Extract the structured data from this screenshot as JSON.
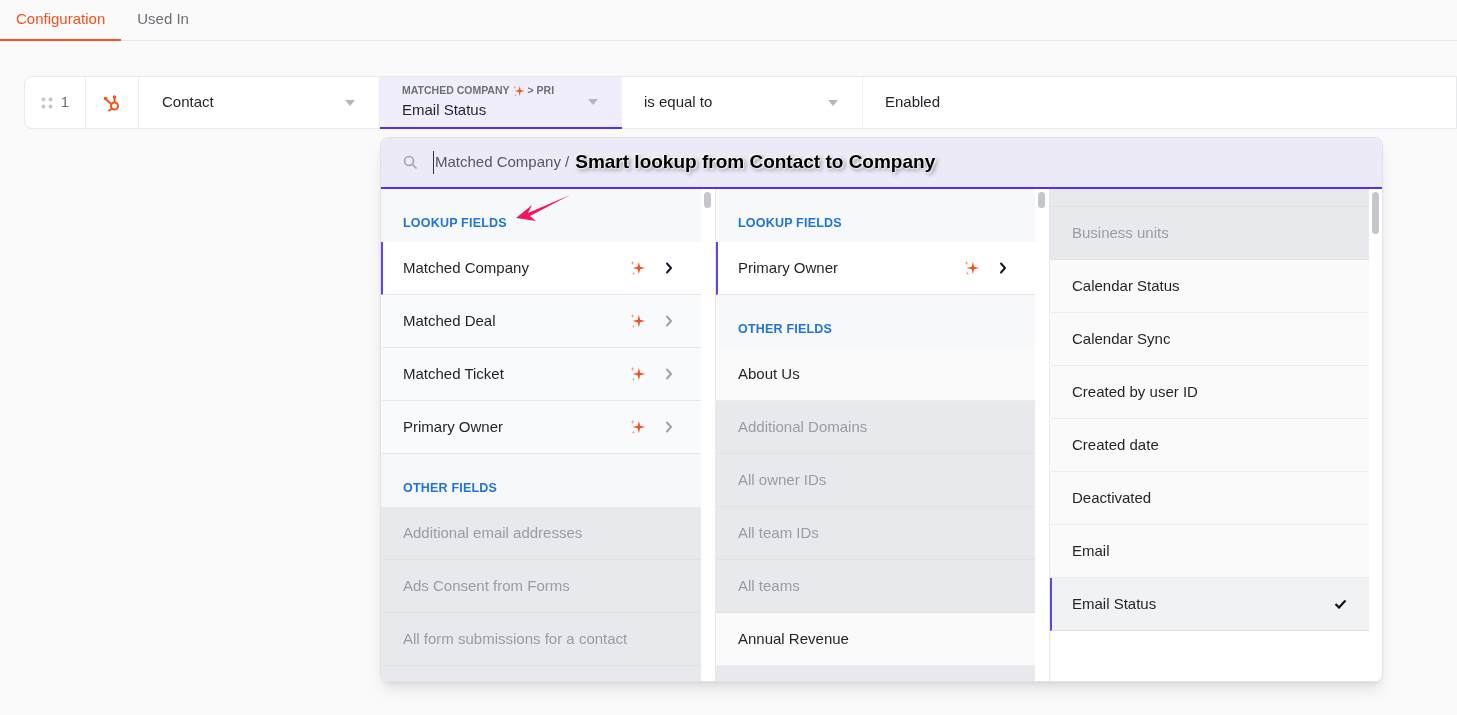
{
  "tabs": [
    {
      "label": "Configuration",
      "selected": true
    },
    {
      "label": "Used In",
      "selected": false
    }
  ],
  "filter_row": {
    "index": "1",
    "object": "Contact",
    "field": {
      "path": "MATCHED COMPANY",
      "path_suffix": "> PRI",
      "value": "Email Status"
    },
    "operator": "is equal to",
    "value": "Enabled"
  },
  "picker": {
    "search": {
      "value": "Matched Company /",
      "annotation": "Smart lookup from Contact to Company"
    },
    "columns": [
      {
        "items": [
          {
            "kind": "header",
            "label": "LOOKUP FIELDS"
          },
          {
            "kind": "lookup",
            "label": "Matched Company",
            "selected": true
          },
          {
            "kind": "lookup",
            "label": "Matched Deal",
            "selected": false
          },
          {
            "kind": "lookup",
            "label": "Matched Ticket",
            "selected": false
          },
          {
            "kind": "lookup",
            "label": "Primary Owner",
            "selected": false
          },
          {
            "kind": "header",
            "label": "OTHER FIELDS"
          },
          {
            "kind": "field",
            "label": "Additional email addresses",
            "disabled": true,
            "selected": false
          },
          {
            "kind": "field",
            "label": "Ads Consent from Forms",
            "disabled": true,
            "selected": false
          },
          {
            "kind": "field",
            "label": "All form submissions for a contact",
            "disabled": true,
            "selected": false
          }
        ]
      },
      {
        "items": [
          {
            "kind": "header",
            "label": "LOOKUP FIELDS"
          },
          {
            "kind": "lookup",
            "label": "Primary Owner",
            "selected": true
          },
          {
            "kind": "header",
            "label": "OTHER FIELDS"
          },
          {
            "kind": "field",
            "label": "About Us",
            "disabled": false,
            "selected": false
          },
          {
            "kind": "field",
            "label": "Additional Domains",
            "disabled": true,
            "selected": false
          },
          {
            "kind": "field",
            "label": "All owner IDs",
            "disabled": true,
            "selected": false
          },
          {
            "kind": "field",
            "label": "All team IDs",
            "disabled": true,
            "selected": false
          },
          {
            "kind": "field",
            "label": "All teams",
            "disabled": true,
            "selected": false
          },
          {
            "kind": "field",
            "label": "Annual Revenue",
            "disabled": false,
            "selected": false
          }
        ]
      },
      {
        "items": [
          {
            "kind": "field",
            "label": "Business units",
            "disabled": true,
            "selected": false
          },
          {
            "kind": "field",
            "label": "Calendar Status",
            "disabled": false,
            "selected": false
          },
          {
            "kind": "field",
            "label": "Calendar Sync",
            "disabled": false,
            "selected": false
          },
          {
            "kind": "field",
            "label": "Created by user ID",
            "disabled": false,
            "selected": false
          },
          {
            "kind": "field",
            "label": "Created date",
            "disabled": false,
            "selected": false
          },
          {
            "kind": "field",
            "label": "Deactivated",
            "disabled": false,
            "selected": false
          },
          {
            "kind": "field",
            "label": "Email",
            "disabled": false,
            "selected": false
          },
          {
            "kind": "field",
            "label": "Email Status",
            "disabled": false,
            "selected": true
          }
        ]
      }
    ]
  }
}
